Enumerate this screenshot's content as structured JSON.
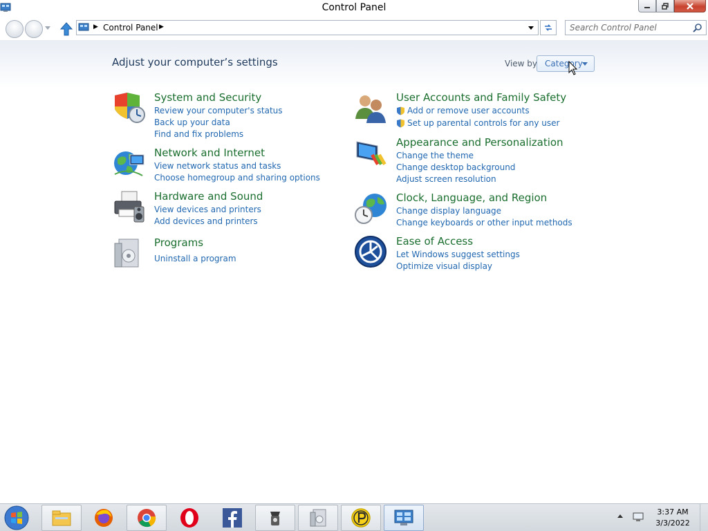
{
  "window": {
    "title": "Control Panel"
  },
  "address": {
    "path": "Control Panel",
    "search_placeholder": "Search Control Panel"
  },
  "main": {
    "heading": "Adjust your computer’s settings",
    "viewby_label": "View by:",
    "viewby_value": "Category"
  },
  "categories": {
    "system": {
      "title": "System and Security",
      "links": [
        "Review your computer's status",
        "Back up your data",
        "Find and fix problems"
      ]
    },
    "network": {
      "title": "Network and Internet",
      "links": [
        "View network status and tasks",
        "Choose homegroup and sharing options"
      ]
    },
    "hardware": {
      "title": "Hardware and Sound",
      "links": [
        "View devices and printers",
        "Add devices and printers"
      ]
    },
    "programs": {
      "title": "Programs",
      "links": [
        "Uninstall a program"
      ]
    },
    "users": {
      "title": "User Accounts and Family Safety",
      "links": [
        "Add or remove user accounts",
        "Set up parental controls for any user"
      ]
    },
    "appearance": {
      "title": "Appearance and Personalization",
      "links": [
        "Change the theme",
        "Change desktop background",
        "Adjust screen resolution"
      ]
    },
    "clock": {
      "title": "Clock, Language, and Region",
      "links": [
        "Change display language",
        "Change keyboards or other input methods"
      ]
    },
    "ease": {
      "title": "Ease of Access",
      "links": [
        "Let Windows suggest settings",
        "Optimize visual display"
      ]
    }
  },
  "taskbar": {
    "items": [
      "file-explorer-icon",
      "firefox-icon",
      "chrome-icon",
      "opera-icon",
      "facebook-icon",
      "coffee-app-icon",
      "programs-app-icon",
      "p-app-icon",
      "control-panel-icon"
    ],
    "time": "3:37 AM",
    "date": "3/3/2022"
  },
  "colors": {
    "category_title": "#1a6e2e",
    "link": "#2067b0",
    "heading": "#1e395b"
  }
}
